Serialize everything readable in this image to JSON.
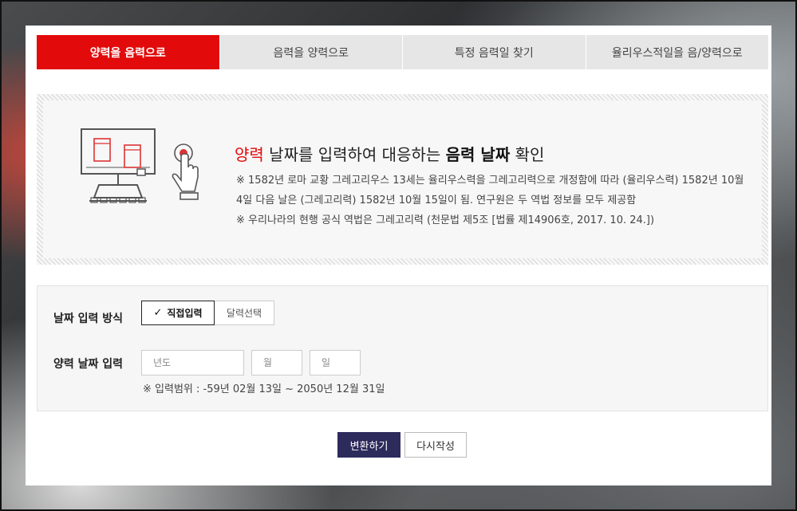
{
  "tabs": [
    {
      "label": "양력을 음력으로",
      "active": true
    },
    {
      "label": "음력을 양력으로",
      "active": false
    },
    {
      "label": "특정 음력일 찾기",
      "active": false
    },
    {
      "label": "율리우스적일을 음/양력으로",
      "active": false
    }
  ],
  "intro": {
    "title_red": "양력",
    "title_mid": " 날짜를 입력하여 대응하는 ",
    "title_bold": "음력 날짜",
    "title_end": " 확인",
    "note1": "※ 1582년 로마 교황 그레고리우스 13세는 율리우스력을 그레고리력으로 개정함에 따라 (율리우스력) 1582년 10월 4일 다음 날은 (그레고리력) 1582년 10월 15일이 됨. 연구원은 두 역법 정보를 모두 제공함",
    "note2": "※ 우리나라의 현행 공식 역법은 그레고리력 (천문법 제5조 [법률 제14906호, 2017. 10. 24.])"
  },
  "form": {
    "method_label": "날짜 입력 방식",
    "method_options": [
      {
        "label": "직접입력",
        "selected": true
      },
      {
        "label": "달력선택",
        "selected": false
      }
    ],
    "date_label": "양력 날짜 입력",
    "year_placeholder": "년도",
    "month_placeholder": "월",
    "day_placeholder": "일",
    "range_note": "※ 입력범위 : -59년 02월 13일 ~ 2050년 12월 31일"
  },
  "actions": {
    "convert_label": "변환하기",
    "reset_label": "다시작성"
  },
  "colors": {
    "accent": "#e20a0a",
    "primary_button": "#2d2a5c"
  }
}
